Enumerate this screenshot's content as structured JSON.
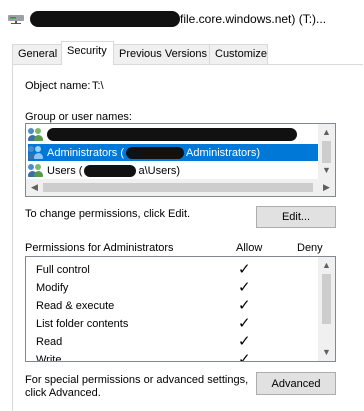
{
  "window": {
    "title": "file.core.windows.net) (T:)..."
  },
  "tabs": [
    {
      "label": "General"
    },
    {
      "label": "Security"
    },
    {
      "label": "Previous Versions"
    },
    {
      "label": "Customize"
    }
  ],
  "object_name": {
    "label": "Object name:",
    "value": "T:\\"
  },
  "group_section": {
    "label": "Group or user names:",
    "items": [
      {
        "text": ""
      },
      {
        "text": "Administrators (",
        "text_after": "Administrators)"
      },
      {
        "text": "Users (",
        "text_after": "a\\Users)"
      }
    ]
  },
  "change_permissions": {
    "text": "To change permissions, click Edit.",
    "button": "Edit..."
  },
  "permissions": {
    "header": "Permissions for Administrators",
    "allow_header": "Allow",
    "deny_header": "Deny",
    "rows": [
      {
        "name": "Full control",
        "allow": true,
        "deny": false
      },
      {
        "name": "Modify",
        "allow": true,
        "deny": false
      },
      {
        "name": "Read & execute",
        "allow": true,
        "deny": false
      },
      {
        "name": "List folder contents",
        "allow": true,
        "deny": false
      },
      {
        "name": "Read",
        "allow": true,
        "deny": false
      },
      {
        "name": "Write",
        "allow": true,
        "deny": false
      }
    ],
    "check_glyph": "✓"
  },
  "advanced": {
    "text_line1": "For special permissions or advanced settings,",
    "text_line2": "click Advanced.",
    "button": "Advanced"
  },
  "icons": {
    "drive": "network-drive-icon",
    "user": "user-group-icon"
  },
  "colors": {
    "selection": "#0078d7"
  }
}
